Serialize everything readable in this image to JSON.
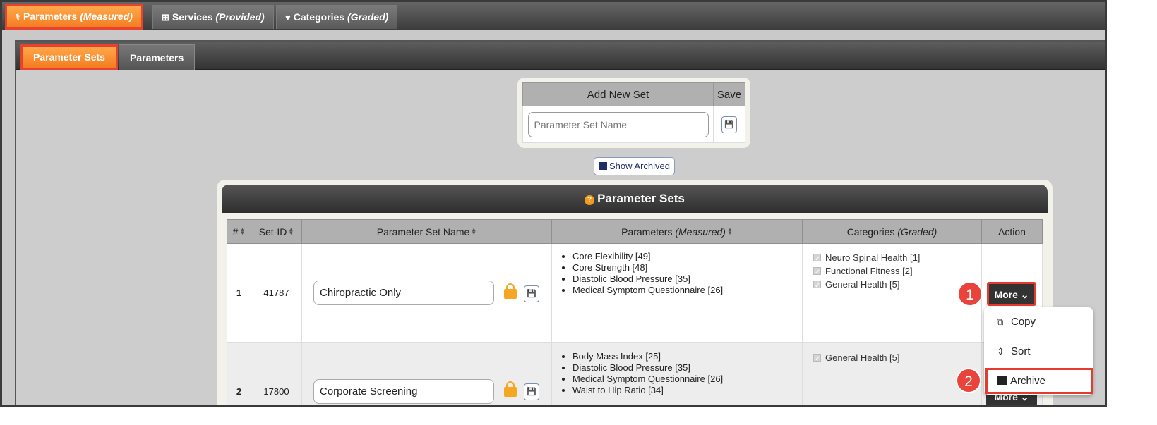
{
  "top_tabs": [
    {
      "label": "Parameters",
      "em": "(Measured)"
    },
    {
      "label": "Services",
      "em": "(Provided)"
    },
    {
      "label": "Categories",
      "em": "(Graded)"
    }
  ],
  "sub_tabs": [
    "Parameter Sets",
    "Parameters"
  ],
  "add_set": {
    "header_name": "Add New Set",
    "header_save": "Save",
    "placeholder": "Parameter Set Name"
  },
  "show_archived_label": "Show Archived",
  "panel_title": "Parameter Sets",
  "columns": {
    "num": "#",
    "set_id": "Set-ID",
    "name": "Parameter Set Name",
    "params": "Parameters",
    "params_em": "(Measured)",
    "cats": "Categories",
    "cats_em": "(Graded)",
    "action": "Action"
  },
  "rows": [
    {
      "num": "1",
      "set_id": "41787",
      "name": "Chiropractic Only",
      "params": [
        "Core Flexibility [49]",
        "Core Strength [48]",
        "Diastolic Blood Pressure [35]",
        "Medical Symptom Questionnaire [26]"
      ],
      "cats": [
        "Neuro Spinal Health [1]",
        "Functional Fitness [2]",
        "General Health [5]"
      ]
    },
    {
      "num": "2",
      "set_id": "17800",
      "name": "Corporate Screening",
      "params": [
        "Body Mass Index [25]",
        "Diastolic Blood Pressure [35]",
        "Medical Symptom Questionnaire [26]",
        "Waist to Hip Ratio [34]"
      ],
      "cats": [
        "General Health [5]"
      ]
    }
  ],
  "more_label": "More",
  "menu": {
    "copy": "Copy",
    "sort": "Sort",
    "archive": "Archive"
  },
  "callouts": [
    "1",
    "2"
  ],
  "colors": {
    "accent": "#f47c20",
    "highlight": "#e33b2e",
    "callout": "#e8443b"
  }
}
